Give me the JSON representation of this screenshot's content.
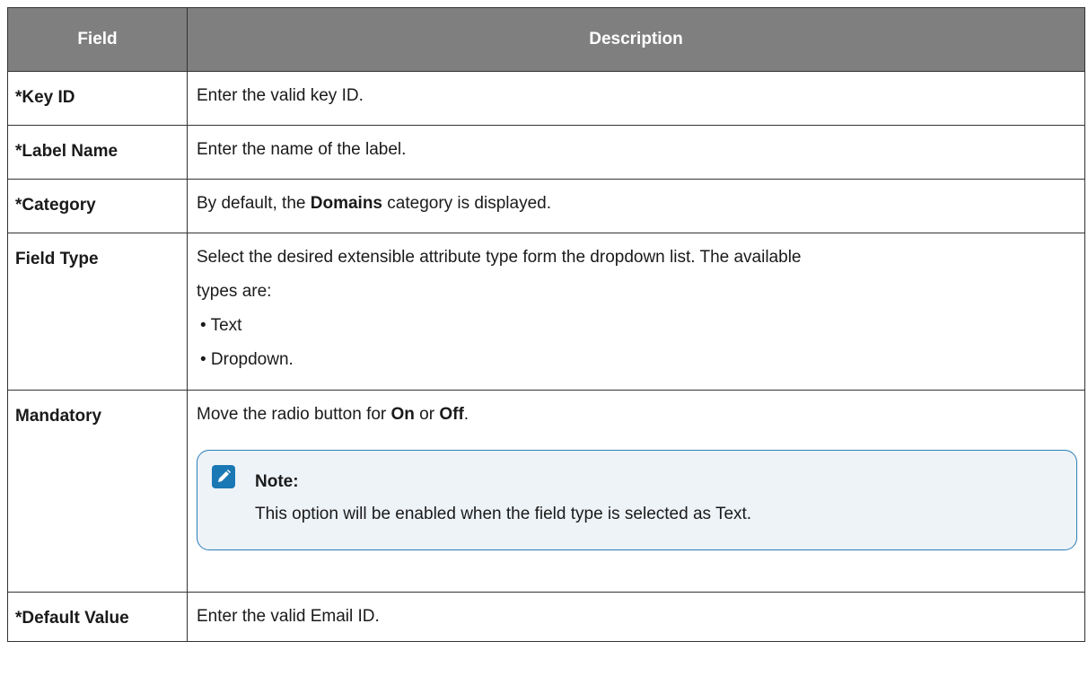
{
  "table": {
    "headers": {
      "field": "Field",
      "description": "Description"
    },
    "rows": {
      "key_id": {
        "field": "*Key ID",
        "description": "Enter the valid key ID."
      },
      "label_name": {
        "field": "*Label Name",
        "description": "Enter the name of the label."
      },
      "category": {
        "field": "*Category",
        "desc_before": "By default, the ",
        "desc_bold": "Domains",
        "desc_after": " category is displayed."
      },
      "field_type": {
        "field": "Field Type",
        "desc_line1": "Select the desired extensible attribute type form the dropdown list. The available",
        "desc_line2": "types are:",
        "bullets": [
          "• Text",
          "• Dropdown."
        ]
      },
      "mandatory": {
        "field": "Mandatory",
        "desc_before": "Move the radio button for ",
        "desc_on": "On",
        "desc_mid": " or ",
        "desc_off": "Off",
        "desc_after": ".",
        "note_title": "Note:",
        "note_text": "This option will be enabled when the field type is selected as Text.",
        "note_icon": "pencil-note-icon"
      },
      "default_value": {
        "field": "*Default Value",
        "description": "Enter the valid Email ID."
      }
    }
  },
  "colors": {
    "header_bg": "#7f7f7f",
    "note_border": "#2a7fb6",
    "note_bg": "#eef3f8",
    "icon_bg": "#1a78b4"
  }
}
